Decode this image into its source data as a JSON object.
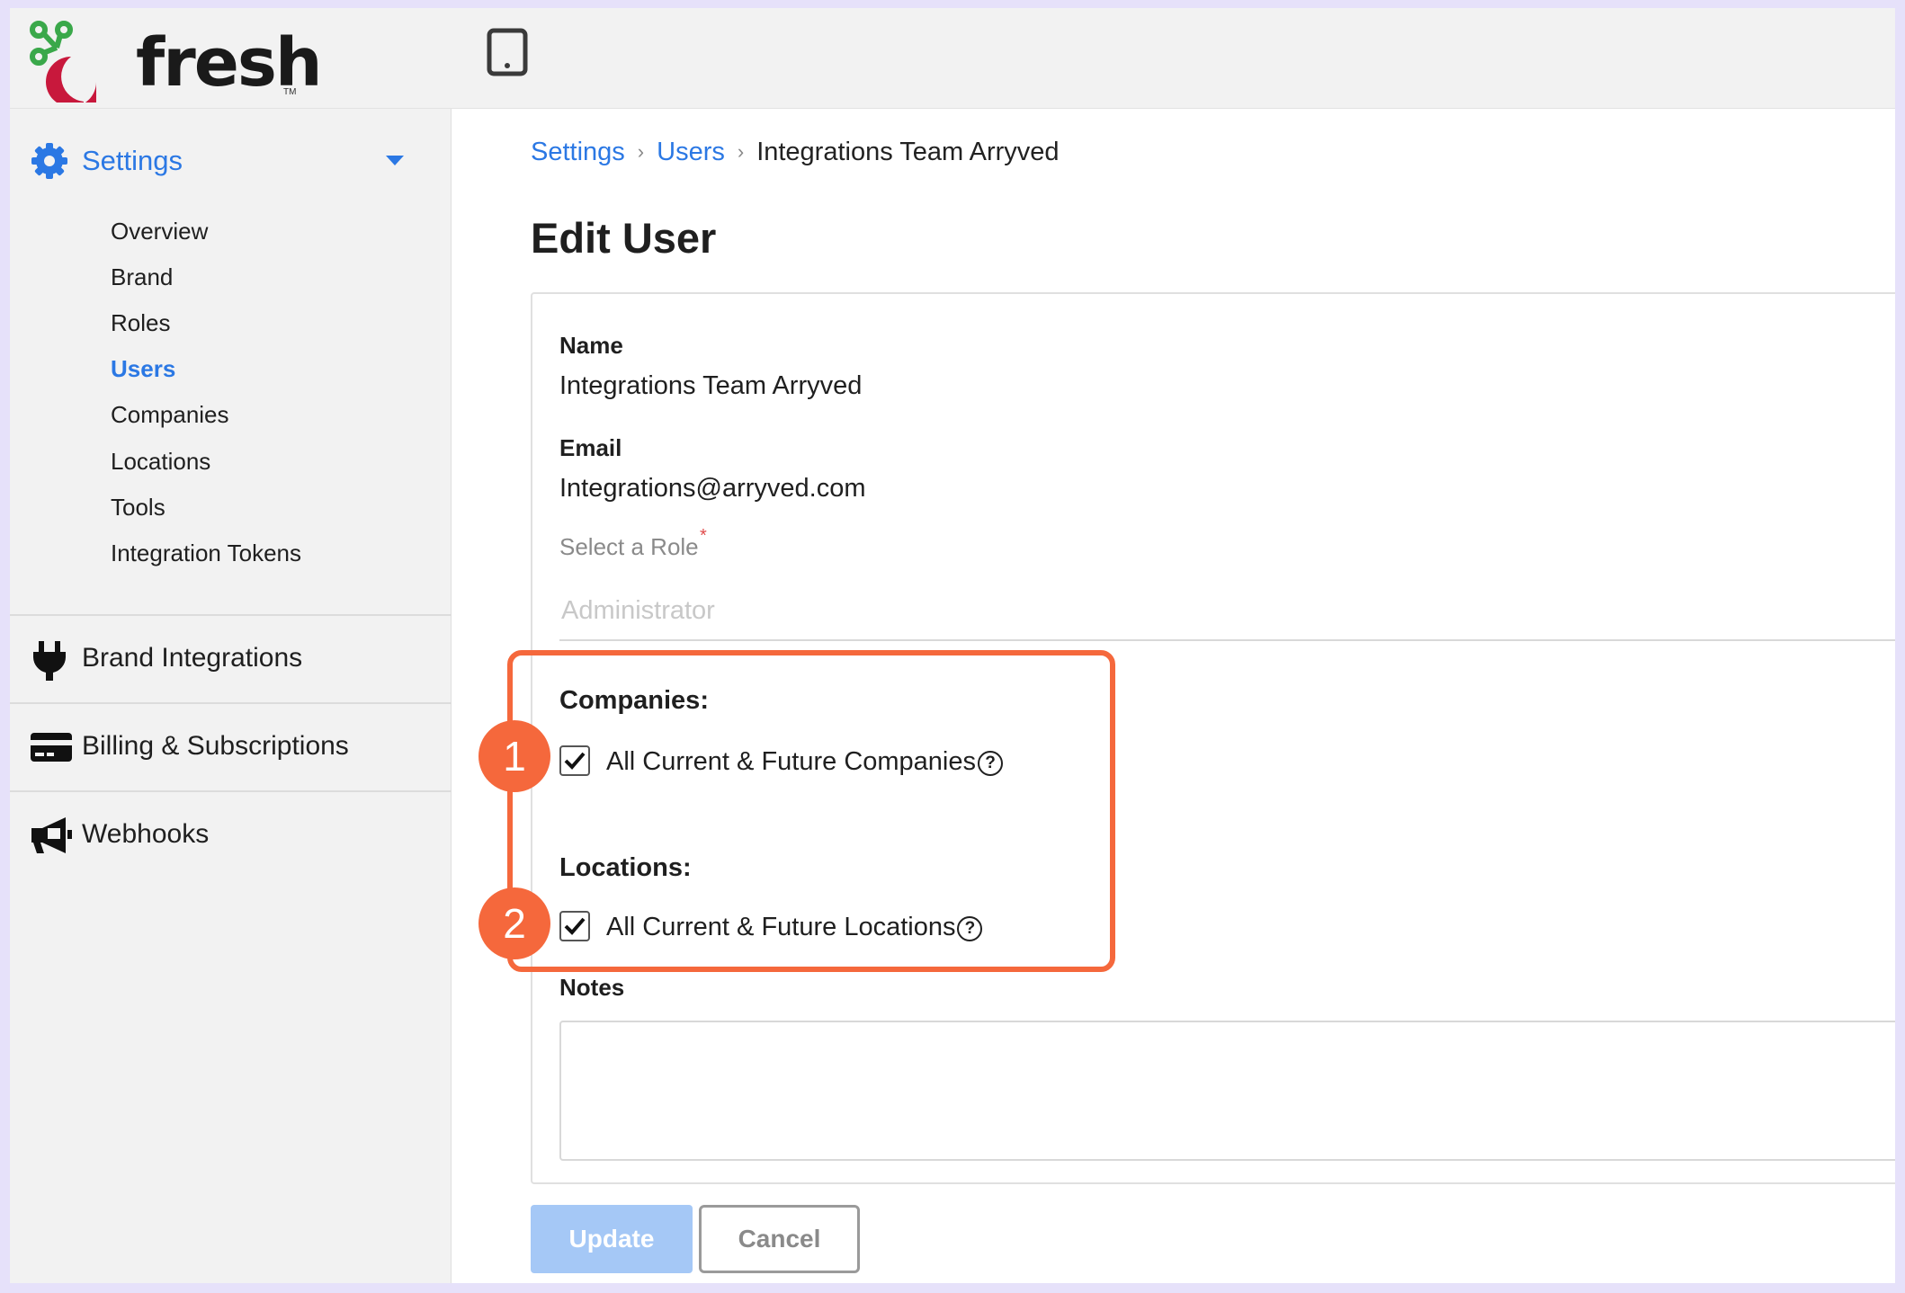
{
  "app": {
    "logo_text": "fresh",
    "logo_tm": "TM",
    "brand_colors": {
      "green": "#3aa84a",
      "red": "#c8183c",
      "accent": "#2b78e4",
      "annotation": "#f5683c"
    }
  },
  "sidebar": {
    "settings_label": "Settings",
    "subnav": [
      "Overview",
      "Brand",
      "Roles",
      "Users",
      "Companies",
      "Locations",
      "Tools",
      "Integration Tokens"
    ],
    "active_item": "Users",
    "sections": [
      {
        "label": "Brand Integrations",
        "icon": "plug-icon"
      },
      {
        "label": "Billing & Subscriptions",
        "icon": "credit-card-icon"
      },
      {
        "label": "Webhooks",
        "icon": "megaphone-icon"
      }
    ]
  },
  "breadcrumb": {
    "items": [
      "Settings",
      "Users"
    ],
    "current": "Integrations Team Arryved"
  },
  "page": {
    "title": "Edit User"
  },
  "form": {
    "name_label": "Name",
    "name_value": "Integrations Team Arryved",
    "email_label": "Email",
    "email_value": "Integrations@arryved.com",
    "role_label": "Select a Role",
    "role_required": "*",
    "role_value": "Administrator",
    "companies_label": "Companies:",
    "companies_option": "All Current & Future Companies",
    "companies_checked": true,
    "locations_label": "Locations:",
    "locations_option": "All Current & Future Locations",
    "locations_checked": true,
    "help_glyph": "?",
    "notes_label": "Notes",
    "notes_value": ""
  },
  "actions": {
    "update_label": "Update",
    "cancel_label": "Cancel"
  },
  "annotations": {
    "badge_1": "1",
    "badge_2": "2"
  }
}
